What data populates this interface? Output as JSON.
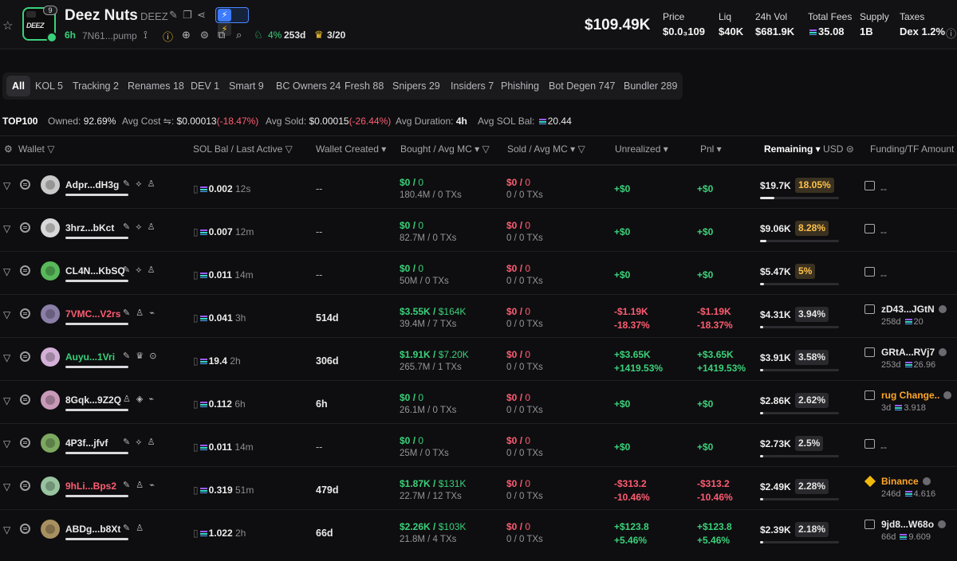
{
  "token": {
    "name": "Deez Nuts",
    "symbol": "DEEZ",
    "logo_badge": "9",
    "logo_text": "DEEZ",
    "age": "6h",
    "address": "7N61...pump",
    "holders_rate": "4%",
    "holders_count": "253d",
    "top_ratio": "3/20"
  },
  "market": {
    "mcap": "$109.49K",
    "stats": [
      {
        "label": "Price",
        "value": "$0.0₃109"
      },
      {
        "label": "Liq",
        "value": "$40K"
      },
      {
        "label": "24h Vol",
        "value": "$681.9K"
      },
      {
        "label": "Total Fees",
        "value": "35.08"
      },
      {
        "label": "Supply",
        "value": "1B"
      },
      {
        "label": "Taxes",
        "value": "Dex 1.2%"
      }
    ]
  },
  "tabs": [
    "All",
    "KOL 5",
    "Tracking 2",
    "Renames 18",
    "DEV 1",
    "Smart 9",
    "BC Owners 24",
    "Fresh 88",
    "Snipers 29",
    "Insiders 7",
    "Phishing",
    "Bot Degen 747",
    "Bundler 289"
  ],
  "summary": {
    "top_label": "TOP100",
    "owned_label": "Owned:",
    "owned": "92.69%",
    "avg_cost_label": "Avg Cost ⇋:",
    "avg_cost": "$0.00013",
    "avg_cost_chg": "(-18.47%)",
    "avg_sold_label": "Avg Sold:",
    "avg_sold": "$0.00015",
    "avg_sold_chg": "(-26.44%)",
    "avg_dur_label": "Avg Duration:",
    "avg_dur": "4h",
    "avg_sol_label": "Avg SOL Bal:",
    "avg_sol": "20.44"
  },
  "columns": {
    "wallet": "Wallet",
    "sol": "SOL Bal / Last Active",
    "created": "Wallet Created",
    "bought": "Bought / Avg MC",
    "sold": "Sold / Avg MC",
    "unrealized": "Unrealized",
    "pnl": "Pnl",
    "remaining": "Remaining",
    "usd": "USD",
    "funding": "Funding/TF Amount"
  },
  "rows": [
    {
      "wallet": "Adpr...dH3g",
      "color": "#eaeaea",
      "avatar": "#c9c9c9",
      "icons": "✎ ⟡ ♙",
      "sol": "0.002",
      "last": "12s",
      "created": "--",
      "bought": "$0",
      "bought_mc": "0",
      "bought_sub": "180.4M / 0 TXs",
      "sold": "$0",
      "sold_mc": "0",
      "sold_sub": "0 / 0 TXs",
      "unreal": "+$0",
      "unreal_pct": "",
      "pnl": "+$0",
      "pnl_pct": "",
      "rem": "$19.7K",
      "rem_pct": "18.05%",
      "rem_frac": 0.18,
      "fund": "--",
      "fund_sub": ""
    },
    {
      "wallet": "3hrz...bKct",
      "color": "#eaeaea",
      "avatar": "#d8d8d8",
      "icons": "✎ ⟡ ♙",
      "sol": "0.007",
      "last": "12m",
      "created": "--",
      "bought": "$0",
      "bought_mc": "0",
      "bought_sub": "82.7M / 0 TXs",
      "sold": "$0",
      "sold_mc": "0",
      "sold_sub": "0 / 0 TXs",
      "unreal": "+$0",
      "unreal_pct": "",
      "pnl": "+$0",
      "pnl_pct": "",
      "rem": "$9.06K",
      "rem_pct": "8.28%",
      "rem_frac": 0.08,
      "fund": "--",
      "fund_sub": ""
    },
    {
      "wallet": "CL4N...KbSQ",
      "color": "#eaeaea",
      "avatar": "#58b85a",
      "icons": "✎ ⟡ ♙",
      "sol": "0.011",
      "last": "14m",
      "created": "--",
      "bought": "$0",
      "bought_mc": "0",
      "bought_sub": "50M / 0 TXs",
      "sold": "$0",
      "sold_mc": "0",
      "sold_sub": "0 / 0 TXs",
      "unreal": "+$0",
      "unreal_pct": "",
      "pnl": "+$0",
      "pnl_pct": "",
      "rem": "$5.47K",
      "rem_pct": "5%",
      "rem_frac": 0.05,
      "fund": "--",
      "fund_sub": ""
    },
    {
      "wallet": "7VMC...V2rs",
      "color": "#ff5c72",
      "avatar": "#8b7fa8",
      "icons": "✎ ♙ ⌁",
      "sol": "0.041",
      "last": "3h",
      "created": "514d",
      "bought": "$3.55K",
      "bought_mc": "$164K",
      "bought_sub": "39.4M / 7 TXs",
      "sold": "$0",
      "sold_mc": "0",
      "sold_sub": "0 / 0 TXs",
      "unreal": "-$1.19K",
      "unreal_pct": "-18.37%",
      "pnl": "-$1.19K",
      "pnl_pct": "-18.37%",
      "rem": "$4.31K",
      "rem_pct": "3.94%",
      "rem_frac": 0.04,
      "fund": "zD43...JGtN",
      "fund_sub": "258d",
      "fund_amt": "20"
    },
    {
      "wallet": "Auyu...1Vri",
      "color": "#3bd17a",
      "avatar": "#d4b0d8",
      "icons": "✎ ♛ ⊙",
      "sol": "19.4",
      "last": "2h",
      "created": "306d",
      "bought": "$1.91K",
      "bought_mc": "$7.20K",
      "bought_sub": "265.7M / 1 TXs",
      "sold": "$0",
      "sold_mc": "0",
      "sold_sub": "0 / 0 TXs",
      "unreal": "+$3.65K",
      "unreal_pct": "+1419.53%",
      "pnl": "+$3.65K",
      "pnl_pct": "+1419.53%",
      "rem": "$3.91K",
      "rem_pct": "3.58%",
      "rem_frac": 0.04,
      "fund": "GRtA...RVj7",
      "fund_sub": "253d",
      "fund_amt": "26.96"
    },
    {
      "wallet": "8Gqk...9Z2Q",
      "color": "#eaeaea",
      "avatar": "#c89ab8",
      "icons": "♙ ◈ ⌁",
      "sol": "0.112",
      "last": "6h",
      "created": "6h",
      "bought": "$0",
      "bought_mc": "0",
      "bought_sub": "26.1M / 0 TXs",
      "sold": "$0",
      "sold_mc": "0",
      "sold_sub": "0 / 0 TXs",
      "unreal": "+$0",
      "unreal_pct": "",
      "pnl": "+$0",
      "pnl_pct": "",
      "rem": "$2.86K",
      "rem_pct": "2.62%",
      "rem_frac": 0.03,
      "fund": "rug Change..",
      "fund_sub": "3d",
      "fund_amt": "3.918",
      "fund_orange": true
    },
    {
      "wallet": "4P3f...jfvf",
      "color": "#eaeaea",
      "avatar": "#7ca860",
      "icons": "✎ ⟡ ♙",
      "sol": "0.011",
      "last": "14m",
      "created": "--",
      "bought": "$0",
      "bought_mc": "0",
      "bought_sub": "25M / 0 TXs",
      "sold": "$0",
      "sold_mc": "0",
      "sold_sub": "0 / 0 TXs",
      "unreal": "+$0",
      "unreal_pct": "",
      "pnl": "+$0",
      "pnl_pct": "",
      "rem": "$2.73K",
      "rem_pct": "2.5%",
      "rem_frac": 0.03,
      "fund": "--",
      "fund_sub": ""
    },
    {
      "wallet": "9hLi...Bps2",
      "color": "#ff5c72",
      "avatar": "#98c4a0",
      "icons": "✎ ♙ ⌁",
      "sol": "0.319",
      "last": "51m",
      "created": "479d",
      "bought": "$1.87K",
      "bought_mc": "$131K",
      "bought_sub": "22.7M / 12 TXs",
      "sold": "$0",
      "sold_mc": "0",
      "sold_sub": "0 / 0 TXs",
      "unreal": "-$313.2",
      "unreal_pct": "-10.46%",
      "pnl": "-$313.2",
      "pnl_pct": "-10.46%",
      "rem": "$2.49K",
      "rem_pct": "2.28%",
      "rem_frac": 0.02,
      "fund": "Binance",
      "fund_sub": "246d",
      "fund_amt": "4.616",
      "fund_orange": true,
      "fund_bnb": true
    },
    {
      "wallet": "ABDg...b8Xt",
      "color": "#eaeaea",
      "avatar": "#a89060",
      "icons": "✎ ♙",
      "sol": "1.022",
      "last": "2h",
      "created": "66d",
      "bought": "$2.26K",
      "bought_mc": "$103K",
      "bought_sub": "21.8M / 4 TXs",
      "sold": "$0",
      "sold_mc": "0",
      "sold_sub": "0 / 0 TXs",
      "unreal": "+$123.8",
      "unreal_pct": "+5.46%",
      "pnl": "+$123.8",
      "pnl_pct": "+5.46%",
      "rem": "$2.39K",
      "rem_pct": "2.18%",
      "rem_frac": 0.02,
      "fund": "9jd8...W68o",
      "fund_sub": "66d",
      "fund_amt": "9.609"
    }
  ]
}
